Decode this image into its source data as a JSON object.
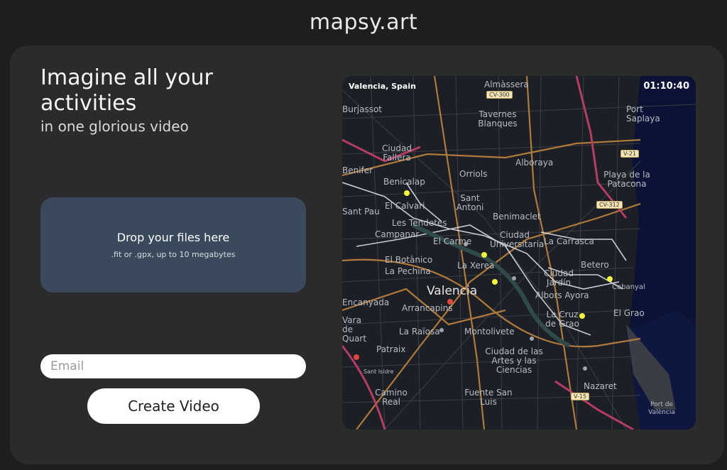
{
  "brand": "mapsy.art",
  "hero": {
    "headline": "Imagine all your activities",
    "subline": "in one glorious video"
  },
  "dropzone": {
    "title": "Drop your files here",
    "hint": ".fit or .gpx, up to 10 megabytes"
  },
  "email": {
    "placeholder": "Email",
    "value": ""
  },
  "create_button": "Create Video",
  "map": {
    "location": "Valencia, Spain",
    "time": "01:10:40",
    "labels": [
      "Almàssera",
      "Tavernes Blanques",
      "Alboraya",
      "Port Saplaya",
      "Playa de la Patacona",
      "Benicalap",
      "Orriols",
      "Sant Antoni",
      "Benimaclet",
      "Campanar",
      "El Carme",
      "Ciudad Universitaria",
      "La Carrasca",
      "El Botànico",
      "La Xerea",
      "Betero",
      "Valencia",
      "Ciudad Jardín",
      "Albors Ayora",
      "Arrancapins",
      "La Cruz de Grao",
      "El Grao",
      "La Raïosa",
      "Montolivete",
      "Ciudad de las Artes y las Ciencias",
      "Nazaret",
      "Camino Real",
      "Fuente San Luis",
      "Ciudad Fallera",
      "El Calvari",
      "Les Tendetes",
      "La Pechina",
      "Patraix",
      "Burjassot",
      "Benifer",
      "Sant Pau",
      "Encanyada",
      "Vara de Quart",
      "Sant Isidre",
      "Port de València",
      "Cabanyal"
    ],
    "road_badges": [
      "CV-300",
      "CV-312",
      "V-21",
      "V-15"
    ]
  }
}
